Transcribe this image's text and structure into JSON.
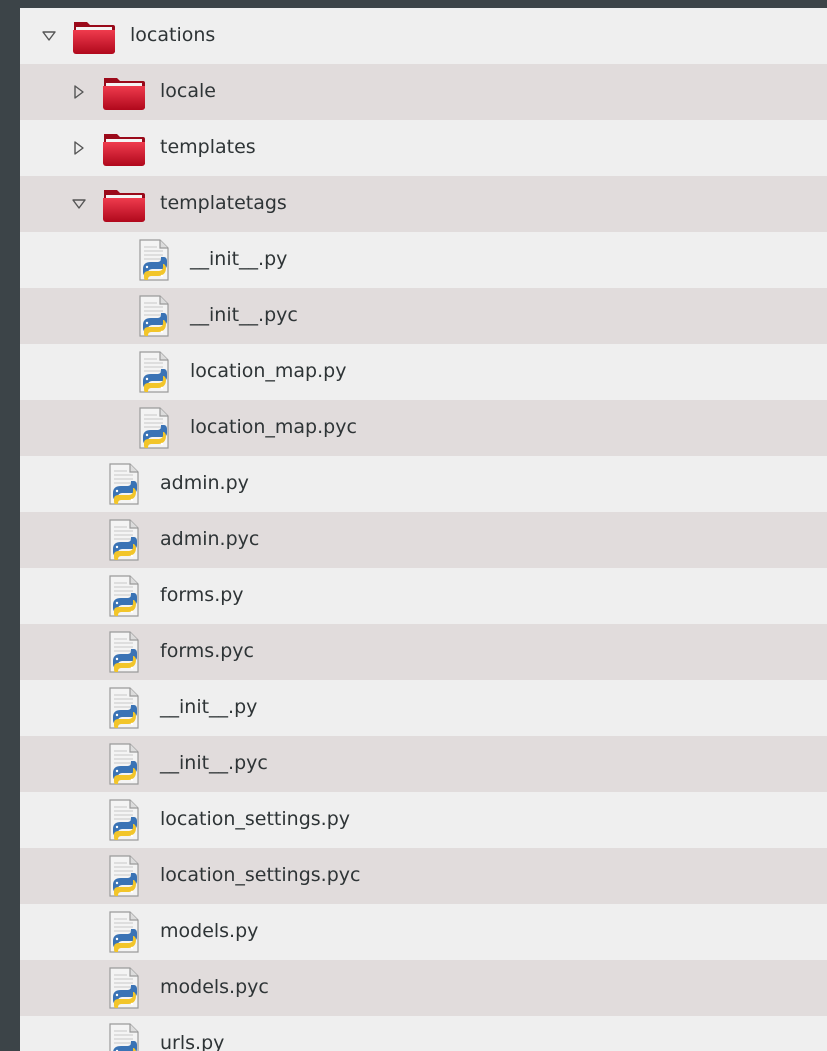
{
  "tree": {
    "rows": [
      {
        "label": "locations",
        "type": "folder",
        "depth": 0,
        "expander": "expanded"
      },
      {
        "label": "locale",
        "type": "folder",
        "depth": 1,
        "expander": "collapsed"
      },
      {
        "label": "templates",
        "type": "folder",
        "depth": 1,
        "expander": "collapsed"
      },
      {
        "label": "templatetags",
        "type": "folder",
        "depth": 1,
        "expander": "expanded"
      },
      {
        "label": "__init__.py",
        "type": "python-file",
        "depth": 2,
        "expander": "none"
      },
      {
        "label": "__init__.pyc",
        "type": "python-file",
        "depth": 2,
        "expander": "none"
      },
      {
        "label": "location_map.py",
        "type": "python-file",
        "depth": 2,
        "expander": "none"
      },
      {
        "label": "location_map.pyc",
        "type": "python-file",
        "depth": 2,
        "expander": "none"
      },
      {
        "label": "admin.py",
        "type": "python-file",
        "depth": 1,
        "expander": "none"
      },
      {
        "label": "admin.pyc",
        "type": "python-file",
        "depth": 1,
        "expander": "none"
      },
      {
        "label": "forms.py",
        "type": "python-file",
        "depth": 1,
        "expander": "none"
      },
      {
        "label": "forms.pyc",
        "type": "python-file",
        "depth": 1,
        "expander": "none"
      },
      {
        "label": "__init__.py",
        "type": "python-file",
        "depth": 1,
        "expander": "none"
      },
      {
        "label": "__init__.pyc",
        "type": "python-file",
        "depth": 1,
        "expander": "none"
      },
      {
        "label": "location_settings.py",
        "type": "python-file",
        "depth": 1,
        "expander": "none"
      },
      {
        "label": "location_settings.pyc",
        "type": "python-file",
        "depth": 1,
        "expander": "none"
      },
      {
        "label": "models.py",
        "type": "python-file",
        "depth": 1,
        "expander": "none"
      },
      {
        "label": "models.pyc",
        "type": "python-file",
        "depth": 1,
        "expander": "none"
      },
      {
        "label": "urls.py",
        "type": "python-file",
        "depth": 1,
        "expander": "none"
      }
    ]
  },
  "colors": {
    "background": "#3c4448",
    "row_light": "#efefef",
    "row_dark": "#e1dcdc",
    "folder_red": "#c8102e",
    "text": "#2e3436"
  }
}
